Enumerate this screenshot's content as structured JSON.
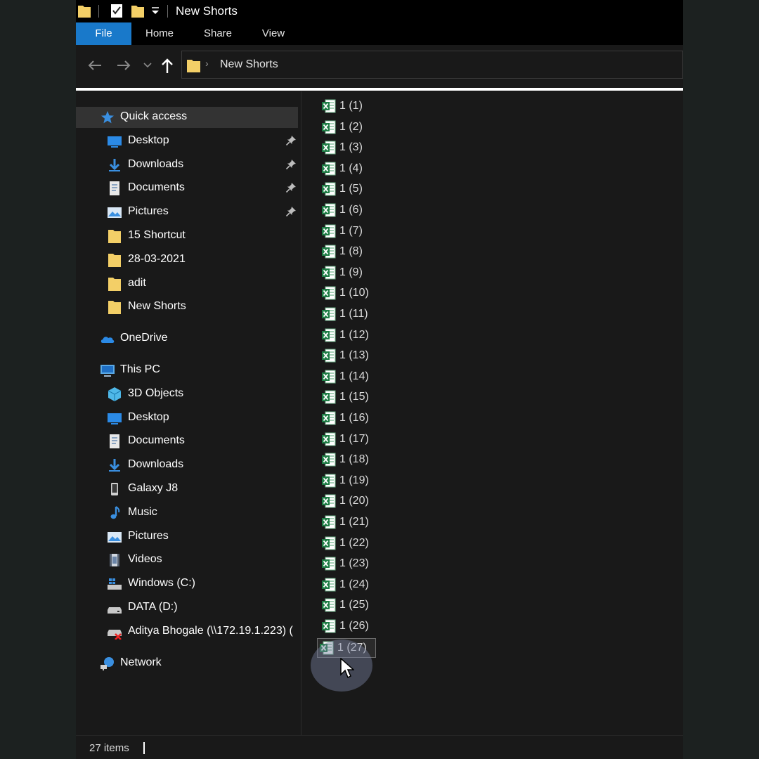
{
  "window": {
    "title": "New Shorts"
  },
  "ribbon": {
    "tabs": [
      "File",
      "Home",
      "Share",
      "View"
    ]
  },
  "address": {
    "path": "New Shorts"
  },
  "nav": {
    "items": [
      {
        "label": "Quick access",
        "icon": "star-icon",
        "indent": 0,
        "selected": true,
        "pinned": false
      },
      {
        "label": "Desktop",
        "icon": "desktop-icon",
        "indent": 1,
        "pinned": true
      },
      {
        "label": "Downloads",
        "icon": "downloads-icon",
        "indent": 1,
        "pinned": true
      },
      {
        "label": "Documents",
        "icon": "documents-icon",
        "indent": 1,
        "pinned": true
      },
      {
        "label": "Pictures",
        "icon": "pictures-icon",
        "indent": 1,
        "pinned": true
      },
      {
        "label": "15 Shortcut",
        "icon": "folder-icon",
        "indent": 1,
        "pinned": false
      },
      {
        "label": "28-03-2021",
        "icon": "folder-icon",
        "indent": 1,
        "pinned": false
      },
      {
        "label": "adit",
        "icon": "folder-icon",
        "indent": 1,
        "pinned": false
      },
      {
        "label": "New Shorts",
        "icon": "folder-icon",
        "indent": 1,
        "pinned": false
      },
      {
        "label": "OneDrive",
        "icon": "onedrive-icon",
        "indent": 0,
        "gap": true,
        "pinned": false
      },
      {
        "label": "This PC",
        "icon": "this-pc-icon",
        "indent": 0,
        "gap": true,
        "pinned": false
      },
      {
        "label": "3D Objects",
        "icon": "3d-objects-icon",
        "indent": 1,
        "pinned": false
      },
      {
        "label": "Desktop",
        "icon": "desktop-icon",
        "indent": 1,
        "pinned": false
      },
      {
        "label": "Documents",
        "icon": "documents-icon",
        "indent": 1,
        "pinned": false
      },
      {
        "label": "Downloads",
        "icon": "downloads-icon",
        "indent": 1,
        "pinned": false
      },
      {
        "label": "Galaxy J8",
        "icon": "phone-icon",
        "indent": 1,
        "pinned": false
      },
      {
        "label": "Music",
        "icon": "music-icon",
        "indent": 1,
        "pinned": false
      },
      {
        "label": "Pictures",
        "icon": "pictures-icon",
        "indent": 1,
        "pinned": false
      },
      {
        "label": "Videos",
        "icon": "videos-icon",
        "indent": 1,
        "pinned": false
      },
      {
        "label": "Windows (C:)",
        "icon": "windows-drive-icon",
        "indent": 1,
        "pinned": false
      },
      {
        "label": "DATA (D:)",
        "icon": "drive-icon",
        "indent": 1,
        "pinned": false
      },
      {
        "label": "Aditya Bhogale (\\\\172.19.1.223) (",
        "icon": "network-drive-icon",
        "indent": 1,
        "pinned": false
      },
      {
        "label": "Network",
        "icon": "network-icon",
        "indent": 0,
        "gap": true,
        "pinned": false
      }
    ]
  },
  "files": [
    "1 (1)",
    "1 (2)",
    "1 (3)",
    "1 (4)",
    "1 (5)",
    "1 (6)",
    "1 (7)",
    "1 (8)",
    "1 (9)",
    "1 (10)",
    "1 (11)",
    "1 (12)",
    "1 (13)",
    "1 (14)",
    "1 (15)",
    "1 (16)",
    "1 (17)",
    "1 (18)",
    "1 (19)",
    "1 (20)",
    "1 (21)",
    "1 (22)",
    "1 (23)",
    "1 (24)",
    "1 (25)",
    "1 (26)",
    "1 (27)"
  ],
  "hovered_file": "1 (27)",
  "status": {
    "items_text": "27 items"
  },
  "colors": {
    "accent": "#1979ca",
    "excel_green": "#1e7d45",
    "folder_yellow": "#f3cf67"
  }
}
